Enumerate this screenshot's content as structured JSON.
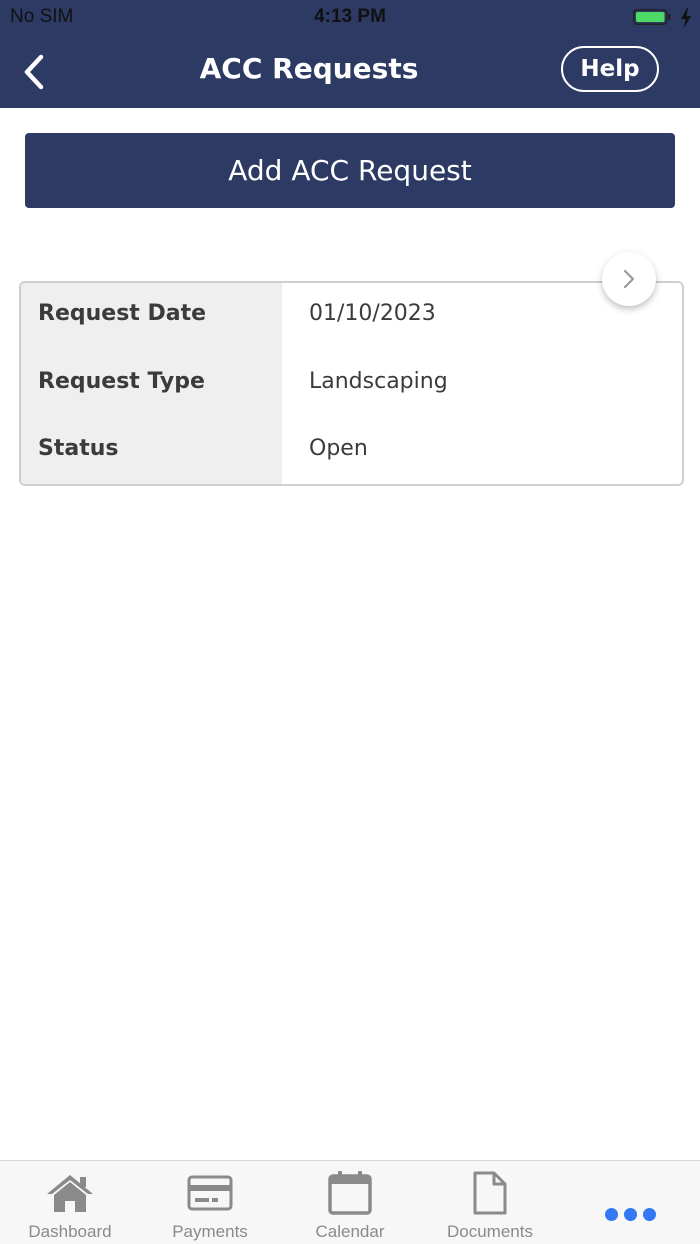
{
  "status_bar": {
    "carrier": "No SIM",
    "time": "4:13 PM",
    "battery_color": "#4cd964"
  },
  "nav": {
    "back_icon": "chevron-left-icon",
    "title": "ACC Requests",
    "help_label": "Help"
  },
  "actions": {
    "add_label": "Add ACC Request"
  },
  "request": {
    "rows": [
      {
        "label": "Request Date",
        "value": "01/10/2023"
      },
      {
        "label": "Request Type",
        "value": "Landscaping"
      },
      {
        "label": "Status",
        "value": "Open"
      }
    ],
    "open_icon": "chevron-right-icon"
  },
  "tabbar": {
    "tabs": [
      {
        "label": "Dashboard",
        "icon": "home-icon"
      },
      {
        "label": "Payments",
        "icon": "credit-card-icon"
      },
      {
        "label": "Calendar",
        "icon": "calendar-icon"
      },
      {
        "label": "Documents",
        "icon": "document-icon"
      },
      {
        "label": "",
        "icon": "more-icon"
      }
    ],
    "active_color": "#3478f6",
    "inactive_color": "#8a8a8a"
  },
  "colors": {
    "primary": "#2c3a64"
  }
}
